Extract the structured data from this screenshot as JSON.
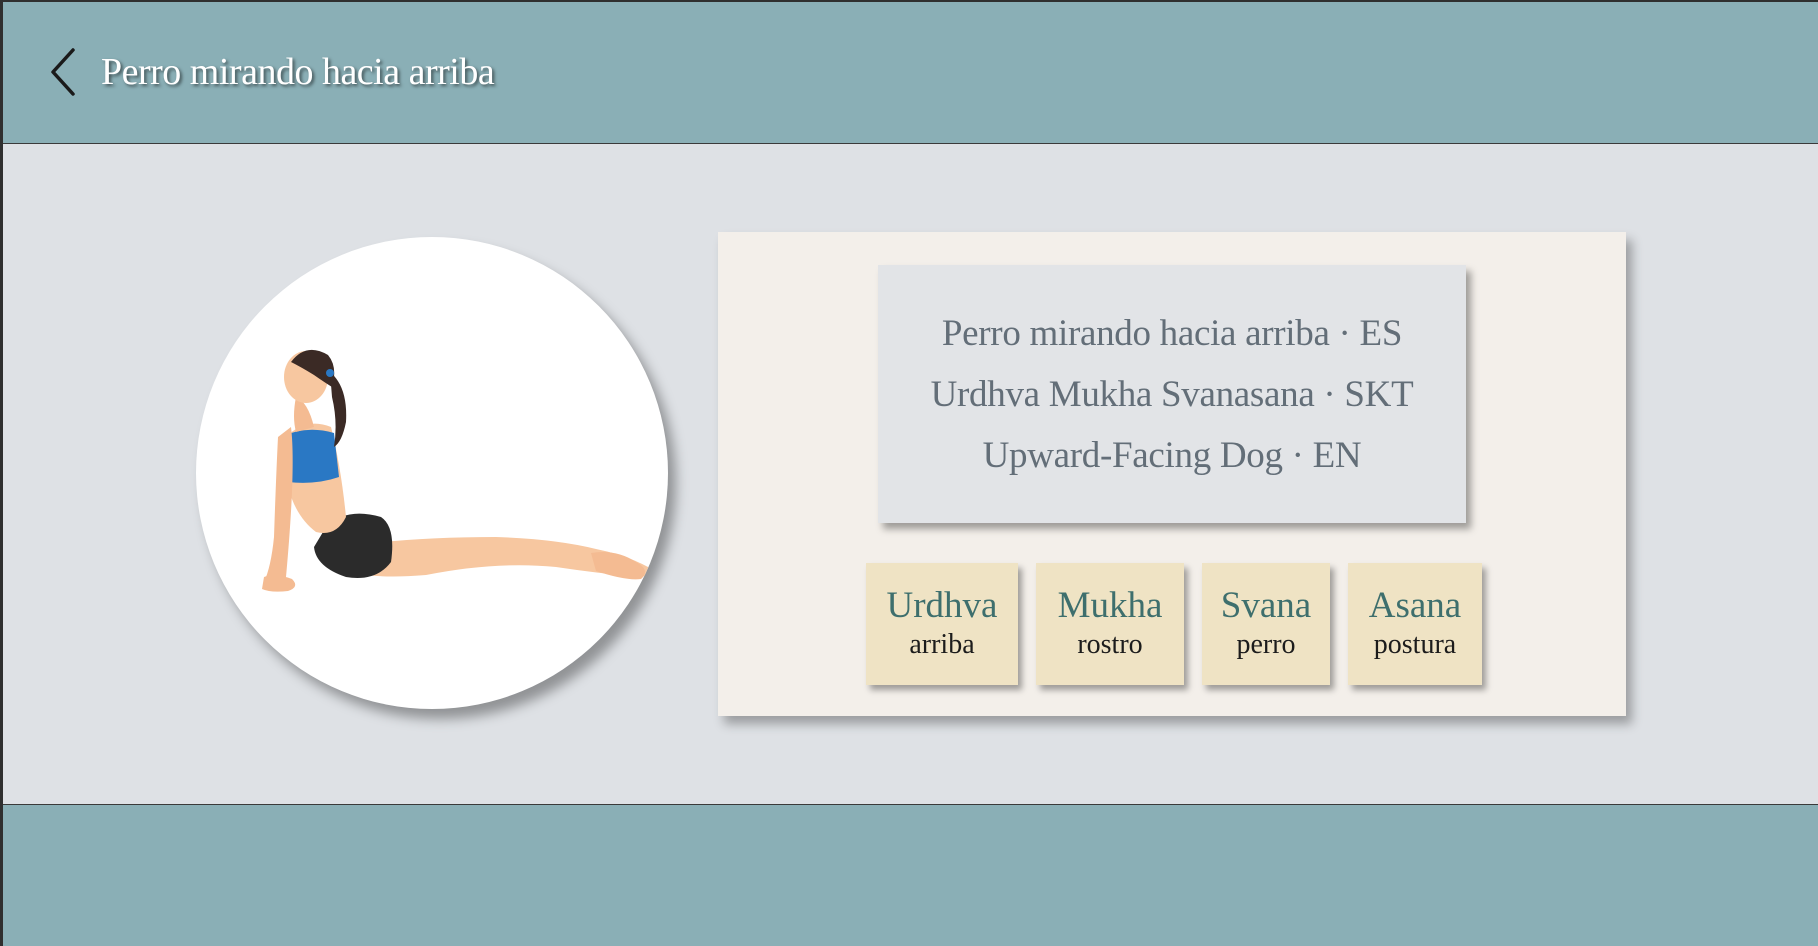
{
  "header": {
    "title": "Perro mirando hacia arriba",
    "back_icon": "chevron-left-icon"
  },
  "pose": {
    "image": "upward-facing-dog-illustration"
  },
  "names": [
    {
      "name": "Perro mirando hacia arriba",
      "lang": "ES",
      "text": "Perro mirando hacia arriba · ES"
    },
    {
      "name": "Urdhva Mukha Svanasana",
      "lang": "SKT",
      "text": "Urdhva Mukha Svanasana · SKT"
    },
    {
      "name": "Upward-Facing Dog",
      "lang": "EN",
      "text": "Upward-Facing Dog · EN"
    }
  ],
  "words": [
    {
      "word": "Urdhva",
      "meaning": "arriba"
    },
    {
      "word": "Mukha",
      "meaning": "rostro"
    },
    {
      "word": "Svana",
      "meaning": "perro"
    },
    {
      "word": "Asana",
      "meaning": "postura"
    }
  ],
  "colors": {
    "header_bg": "#8aafb6",
    "content_bg": "#dee1e5",
    "card_bg": "#f3efea",
    "names_bg": "#e2e4e7",
    "tile_bg": "#efe3c4",
    "tile_word": "#3e6f6d",
    "name_text": "#636e78"
  }
}
